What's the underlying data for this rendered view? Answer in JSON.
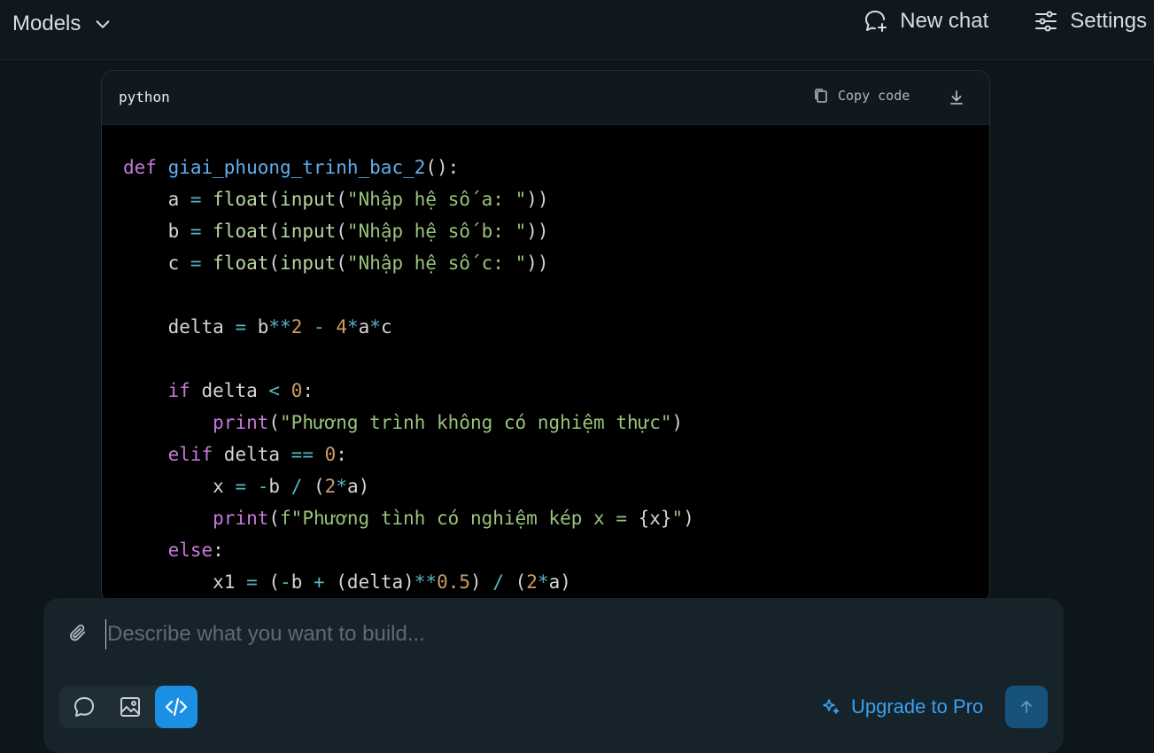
{
  "topbar": {
    "models_label": "Models",
    "new_chat_label": "New chat",
    "settings_label": "Settings"
  },
  "code_block": {
    "language": "python",
    "copy_label": "Copy code",
    "lines": [
      [
        {
          "t": "def ",
          "c": "kw"
        },
        {
          "t": "giai_phuong_trinh_bac_2",
          "c": "fn"
        },
        {
          "t": "():",
          "c": "vr"
        }
      ],
      [
        {
          "t": "    a ",
          "c": "vr"
        },
        {
          "t": "=",
          "c": "op"
        },
        {
          "t": " ",
          "c": "vr"
        },
        {
          "t": "float",
          "c": "bi"
        },
        {
          "t": "(",
          "c": "vr"
        },
        {
          "t": "input",
          "c": "bi"
        },
        {
          "t": "(",
          "c": "vr"
        },
        {
          "t": "\"Nhập hệ số a: \"",
          "c": "st"
        },
        {
          "t": "))",
          "c": "vr"
        }
      ],
      [
        {
          "t": "    b ",
          "c": "vr"
        },
        {
          "t": "=",
          "c": "op"
        },
        {
          "t": " ",
          "c": "vr"
        },
        {
          "t": "float",
          "c": "bi"
        },
        {
          "t": "(",
          "c": "vr"
        },
        {
          "t": "input",
          "c": "bi"
        },
        {
          "t": "(",
          "c": "vr"
        },
        {
          "t": "\"Nhập hệ số b: \"",
          "c": "st"
        },
        {
          "t": "))",
          "c": "vr"
        }
      ],
      [
        {
          "t": "    c ",
          "c": "vr"
        },
        {
          "t": "=",
          "c": "op"
        },
        {
          "t": " ",
          "c": "vr"
        },
        {
          "t": "float",
          "c": "bi"
        },
        {
          "t": "(",
          "c": "vr"
        },
        {
          "t": "input",
          "c": "bi"
        },
        {
          "t": "(",
          "c": "vr"
        },
        {
          "t": "\"Nhập hệ số c: \"",
          "c": "st"
        },
        {
          "t": "))",
          "c": "vr"
        }
      ],
      [],
      [
        {
          "t": "    delta ",
          "c": "vr"
        },
        {
          "t": "=",
          "c": "op"
        },
        {
          "t": " b",
          "c": "vr"
        },
        {
          "t": "**",
          "c": "op"
        },
        {
          "t": "2",
          "c": "nm"
        },
        {
          "t": " ",
          "c": "vr"
        },
        {
          "t": "-",
          "c": "op"
        },
        {
          "t": " ",
          "c": "vr"
        },
        {
          "t": "4",
          "c": "nm"
        },
        {
          "t": "*",
          "c": "op"
        },
        {
          "t": "a",
          "c": "vr"
        },
        {
          "t": "*",
          "c": "op"
        },
        {
          "t": "c",
          "c": "vr"
        }
      ],
      [],
      [
        {
          "t": "    ",
          "c": "vr"
        },
        {
          "t": "if",
          "c": "kw"
        },
        {
          "t": " delta ",
          "c": "vr"
        },
        {
          "t": "<",
          "c": "op"
        },
        {
          "t": " ",
          "c": "vr"
        },
        {
          "t": "0",
          "c": "nm"
        },
        {
          "t": ":",
          "c": "vr"
        }
      ],
      [
        {
          "t": "        ",
          "c": "vr"
        },
        {
          "t": "print",
          "c": "kw"
        },
        {
          "t": "(",
          "c": "vr"
        },
        {
          "t": "\"Phương trình không có nghiệm thực\"",
          "c": "st"
        },
        {
          "t": ")",
          "c": "vr"
        }
      ],
      [
        {
          "t": "    ",
          "c": "vr"
        },
        {
          "t": "elif",
          "c": "kw"
        },
        {
          "t": " delta ",
          "c": "vr"
        },
        {
          "t": "==",
          "c": "op"
        },
        {
          "t": " ",
          "c": "vr"
        },
        {
          "t": "0",
          "c": "nm"
        },
        {
          "t": ":",
          "c": "vr"
        }
      ],
      [
        {
          "t": "        x ",
          "c": "vr"
        },
        {
          "t": "=",
          "c": "op"
        },
        {
          "t": " ",
          "c": "vr"
        },
        {
          "t": "-",
          "c": "op"
        },
        {
          "t": "b ",
          "c": "vr"
        },
        {
          "t": "/",
          "c": "op"
        },
        {
          "t": " (",
          "c": "vr"
        },
        {
          "t": "2",
          "c": "nm"
        },
        {
          "t": "*",
          "c": "op"
        },
        {
          "t": "a)",
          "c": "vr"
        }
      ],
      [
        {
          "t": "        ",
          "c": "vr"
        },
        {
          "t": "print",
          "c": "kw"
        },
        {
          "t": "(",
          "c": "vr"
        },
        {
          "t": "f\"Phương tình có nghiệm kép x = ",
          "c": "st"
        },
        {
          "t": "{x}",
          "c": "vr"
        },
        {
          "t": "\"",
          "c": "st"
        },
        {
          "t": ")",
          "c": "vr"
        }
      ],
      [
        {
          "t": "    ",
          "c": "vr"
        },
        {
          "t": "else",
          "c": "kw"
        },
        {
          "t": ":",
          "c": "vr"
        }
      ],
      [
        {
          "t": "        x1 ",
          "c": "vr"
        },
        {
          "t": "=",
          "c": "op"
        },
        {
          "t": " (",
          "c": "vr"
        },
        {
          "t": "-",
          "c": "op"
        },
        {
          "t": "b ",
          "c": "vr"
        },
        {
          "t": "+",
          "c": "op"
        },
        {
          "t": " (delta)",
          "c": "vr"
        },
        {
          "t": "**",
          "c": "op"
        },
        {
          "t": "0.5",
          "c": "nm"
        },
        {
          "t": ") ",
          "c": "vr"
        },
        {
          "t": "/",
          "c": "op"
        },
        {
          "t": " (",
          "c": "vr"
        },
        {
          "t": "2",
          "c": "nm"
        },
        {
          "t": "*",
          "c": "op"
        },
        {
          "t": "a)",
          "c": "vr"
        }
      ]
    ]
  },
  "composer": {
    "placeholder": "Describe what you want to build...",
    "value": "",
    "upgrade_label": "Upgrade to Pro",
    "modes": [
      "chat-mode",
      "image-mode",
      "code-mode"
    ],
    "active_mode": "code-mode"
  },
  "colors": {
    "accent": "#1a8fe3",
    "upgrade_text": "#3aa0f0",
    "send_button": "#17527a"
  }
}
